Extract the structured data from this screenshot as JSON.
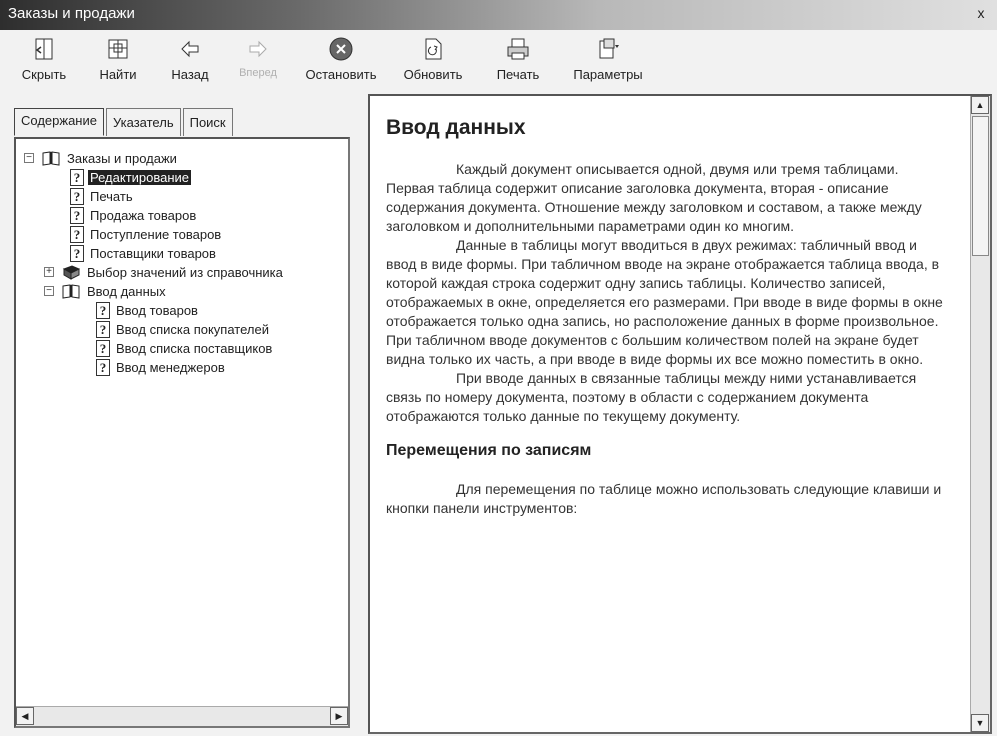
{
  "window": {
    "title": "Заказы и продажи",
    "close_glyph": "x"
  },
  "toolbar": {
    "hide": {
      "label": "Скрыть",
      "icon": "hide-pane-icon"
    },
    "find": {
      "label": "Найти",
      "icon": "find-icon"
    },
    "back": {
      "label": "Назад",
      "icon": "back-arrow-icon"
    },
    "forward": {
      "label": "Вперед",
      "icon": "forward-arrow-icon",
      "disabled": true
    },
    "stop": {
      "label": "Остановить",
      "icon": "stop-icon"
    },
    "refresh": {
      "label": "Обновить",
      "icon": "refresh-icon"
    },
    "print": {
      "label": "Печать",
      "icon": "printer-icon"
    },
    "options": {
      "label": "Параметры",
      "icon": "options-icon"
    }
  },
  "tabs": [
    {
      "label": "Содержание",
      "active": true
    },
    {
      "label": "Указатель",
      "active": false
    },
    {
      "label": "Поиск",
      "active": false
    }
  ],
  "tree": {
    "root": "Заказы и продажи",
    "editing": "Редактирование",
    "print": "Печать",
    "sales": "Продажа товаров",
    "receipt": "Поступление товаров",
    "suppliers": "Поставщики товаров",
    "reference": "Выбор значений из справочника",
    "data_entry": "Ввод данных",
    "goods_entry": "Ввод товаров",
    "buyers_entry": "Ввод списка покупателей",
    "suppliers_entry": "Ввод списка поставщиков",
    "managers_entry": "Ввод менеджеров"
  },
  "content": {
    "heading": "Ввод данных",
    "paragraphs": [
      "Каждый документ описывается одной, двумя или тремя таблицами.  Первая таблица содержит описание заголовка документа, вторая - описание содержания документа. Отношение между заголовком и составом, а также между заголовком и дополнительными параметрами один ко многим.",
      "Данные в таблицы могут вводиться в двух режимах: табличный ввод и ввод в виде формы. При табличном вводе на экране отображается таблица ввода, в которой каждая строка содержит одну запись таблицы. Количество записей, отображаемых в окне, определяется его размерами. При вводе в виде формы в окне отображается только одна запись, но расположение данных в форме произвольное. При табличном вводе документов с большим количеством полей на экране будет видна только их часть, а при вводе в виде формы их все можно поместить в окно.",
      "При вводе данных в связанные таблицы между ними устанавливается связь по номеру документа, поэтому в области с содержанием документа отображаются только данные по текущему документу."
    ],
    "subheading": "Перемещения по записям",
    "paragraph_last": "Для перемещения по таблице можно использовать следующие клавиши и кнопки панели инструментов:"
  }
}
